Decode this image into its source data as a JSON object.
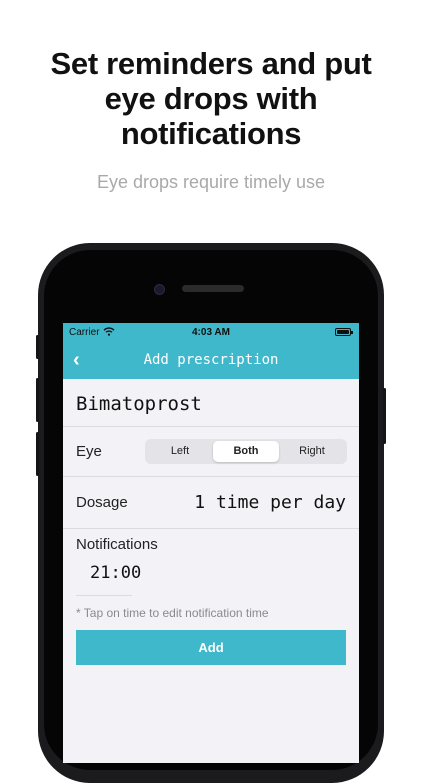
{
  "promo": {
    "headline_lines": [
      "Set reminders and put",
      "eye drops with",
      "notifications"
    ],
    "subheadline": "Eye drops require timely use"
  },
  "status_bar": {
    "carrier": "Carrier",
    "time": "4:03 AM"
  },
  "nav": {
    "back_icon": "‹",
    "title": "Add prescription"
  },
  "form": {
    "drug_name": "Bimatoprost",
    "eye_label": "Eye",
    "eye_options": [
      "Left",
      "Both",
      "Right"
    ],
    "eye_selected": "Both",
    "dosage_label": "Dosage",
    "dosage_value": "1 time per day",
    "notifications_label": "Notifications",
    "notification_times": [
      "21:00"
    ],
    "hint": "* Tap on time to edit notification time",
    "add_label": "Add"
  },
  "colors": {
    "accent": "#3fb8cb",
    "screen_background": "#f2f2f7",
    "phone_body": "#1b1b1d"
  },
  "icons": [
    "back-chevron-icon",
    "wifi-icon",
    "battery-icon"
  ]
}
